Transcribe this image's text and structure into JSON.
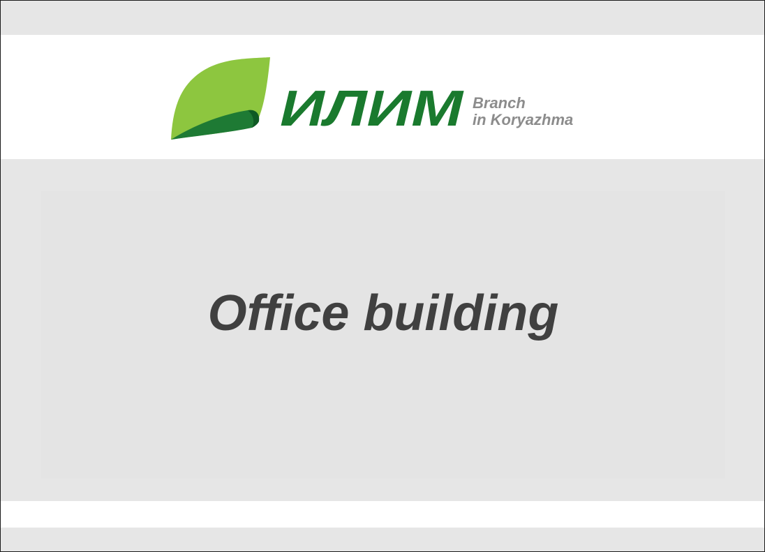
{
  "logo": {
    "wordmark": "ИЛИМ",
    "branch_line1": "Branch",
    "branch_line2": "in Koryazhma",
    "icon": "leaf-logo-icon",
    "colors": {
      "leaf_light": "#8dc63f",
      "leaf_dark": "#1e7a34",
      "wordmark": "#1a7a2e",
      "branch_text": "#8c8c8c"
    }
  },
  "slide": {
    "title": "Office building",
    "colors": {
      "band": "#e6e6e6",
      "title_text": "#404040"
    }
  }
}
